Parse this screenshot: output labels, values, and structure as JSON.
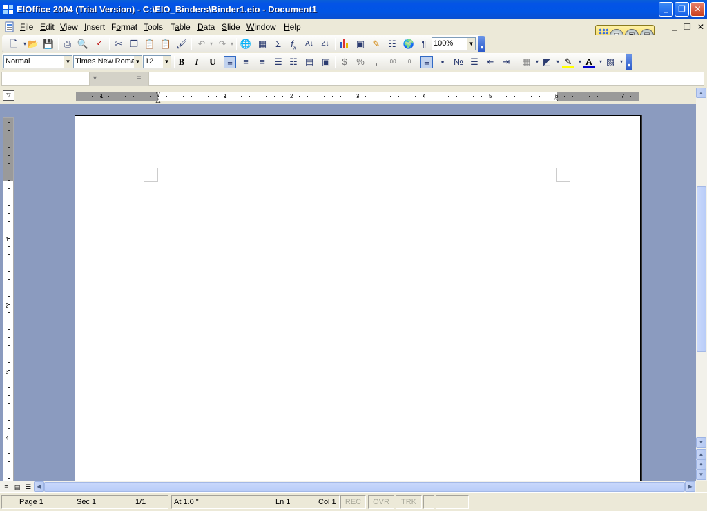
{
  "window": {
    "title": "EIOffice 2004 (Trial Version) - C:\\EIO_Binders\\Binder1.eio - Document1",
    "controls": [
      "minimize",
      "restore",
      "close"
    ],
    "doc_controls": {
      "minimize": "_",
      "restore": "̷",
      "close": "×"
    }
  },
  "menu": [
    {
      "label": "File",
      "key": "F"
    },
    {
      "label": "Edit",
      "key": "E"
    },
    {
      "label": "View",
      "key": "V"
    },
    {
      "label": "Insert",
      "key": "I"
    },
    {
      "label": "Format",
      "key": "o"
    },
    {
      "label": "Tools",
      "key": "T"
    },
    {
      "label": "Table",
      "key": "a"
    },
    {
      "label": "Data",
      "key": "D"
    },
    {
      "label": "Slide",
      "key": "S"
    },
    {
      "label": "Window",
      "key": "W"
    },
    {
      "label": "Help",
      "key": "H"
    }
  ],
  "toolbar_standard": {
    "zoom": "100%",
    "icons": [
      "new-icon",
      "open-icon",
      "save-icon",
      "print-icon",
      "print-preview-icon",
      "spellcheck-icon",
      "cut-icon",
      "copy-icon",
      "paste-icon",
      "paste-special-icon",
      "format-painter-icon",
      "undo-icon",
      "redo-icon",
      "hyperlink-icon",
      "insert-table-icon",
      "sum-icon",
      "function-icon",
      "sort-ascending-icon",
      "sort-descending-icon",
      "chart-icon",
      "insert-object-icon",
      "highlight-tool-icon",
      "tree-icon",
      "web-icon",
      "show-formatting-icon"
    ]
  },
  "toolbar_formatting": {
    "style": "Normal",
    "font": "Times New Roma",
    "size": "12",
    "bold": "B",
    "italic": "I",
    "underline": "U",
    "currency": "$",
    "percent": "%",
    "comma": ",",
    "font_color": "A"
  },
  "formula_bar": {
    "equals": "="
  },
  "ruler": {
    "h_numbers": [
      "1",
      "1",
      "2",
      "3",
      "4",
      "5",
      "6",
      "7"
    ],
    "v_numbers": [
      "1",
      "2",
      "3",
      "4"
    ]
  },
  "status": {
    "page": "Page 1",
    "section": "Sec 1",
    "pages": "1/1",
    "at": "At 1.0 \"",
    "line": "Ln 1",
    "col": "Col 1",
    "rec": "REC",
    "ovr": "OVR",
    "trk": "TRK"
  },
  "colors": {
    "titlebar": "#0055e5",
    "workspace": "#8b9bbf",
    "chrome": "#ece9d8"
  }
}
